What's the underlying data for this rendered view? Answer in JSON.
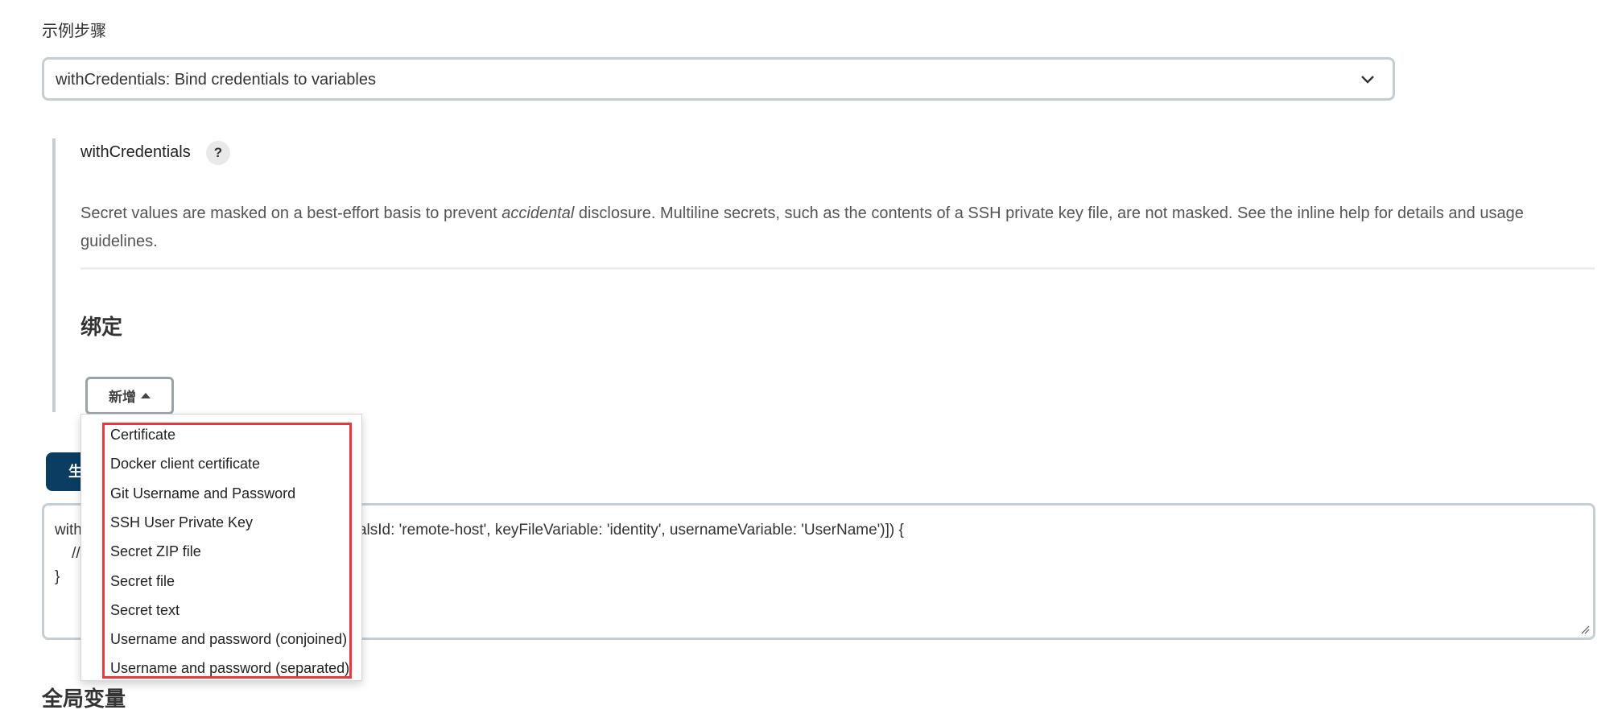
{
  "step_label": "示例步骤",
  "step_select": {
    "value": "withCredentials: Bind credentials to variables",
    "icon": "chevron-down-icon"
  },
  "step": {
    "name": "withCredentials",
    "help_label": "?",
    "description_before": "Secret values are masked on a best-effort basis to prevent ",
    "description_em": "accidental",
    "description_after": " disclosure. Multiline secrets, such as the contents of a SSH private key file, are not masked. See the inline help for details and usage guidelines."
  },
  "bindings": {
    "heading": "绑定",
    "add_button": "新增",
    "menu_items": [
      "Certificate",
      "Docker client certificate",
      "Git Username and Password",
      "SSH User Private Key",
      "Secret ZIP file",
      "Secret file",
      "Secret text",
      "Username and password (conjoined)",
      "Username and password (separated)"
    ]
  },
  "generate_button": "生成流水线脚本",
  "code": {
    "line1": "withCredentials([sshUserPrivateKey(credentialsId: 'remote-host', keyFileVariable: 'identity', usernameVariable: 'UserName')]) {",
    "line2": "    // some block",
    "line3": "}"
  },
  "global_heading": "全局变量",
  "colors": {
    "primary_button": "#0b3d63",
    "highlight_box": "#e8383d",
    "border": "#c5ced4"
  }
}
